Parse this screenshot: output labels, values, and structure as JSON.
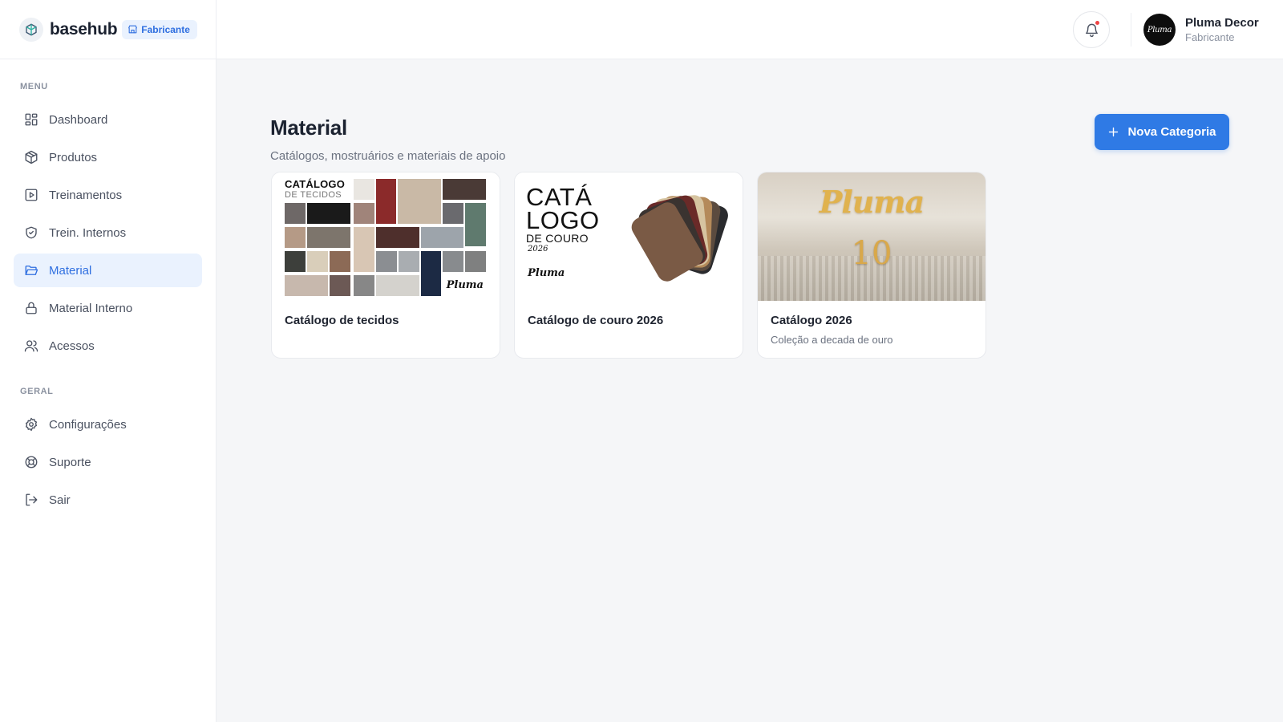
{
  "brand": {
    "name": "basehub",
    "badge": "Fabricante"
  },
  "sidebar": {
    "menu_label": "MENU",
    "menu_items": [
      {
        "label": "Dashboard",
        "icon": "grid-icon"
      },
      {
        "label": "Produtos",
        "icon": "box-icon"
      },
      {
        "label": "Treinamentos",
        "icon": "play-square-icon"
      },
      {
        "label": "Trein. Internos",
        "icon": "shield-icon"
      },
      {
        "label": "Material",
        "icon": "folder-open-icon",
        "active": true
      },
      {
        "label": "Material Interno",
        "icon": "lock-icon"
      },
      {
        "label": "Acessos",
        "icon": "users-icon"
      }
    ],
    "general_label": "GERAL",
    "general_items": [
      {
        "label": "Configurações",
        "icon": "gear-icon"
      },
      {
        "label": "Suporte",
        "icon": "lifebuoy-icon"
      },
      {
        "label": "Sair",
        "icon": "logout-icon"
      }
    ]
  },
  "header": {
    "user": {
      "name": "Pluma Decor",
      "role": "Fabricante",
      "avatar_text": "Pluma"
    }
  },
  "main": {
    "title": "Material",
    "subtitle": "Catálogos, mostruários e materiais de apoio",
    "new_button": "Nova Categoria",
    "cards": [
      {
        "title": "Catálogo de tecidos",
        "description": "",
        "thumb": {
          "heading": "CATÁLOGO",
          "subheading": "DE TECIDOS",
          "logo": "Pluma"
        }
      },
      {
        "title": "Catálogo de couro 2026",
        "description": "",
        "thumb": {
          "heading_line1": "CATÁ",
          "heading_line2": "LOGO",
          "subheading": "DE COURO",
          "year": "2026",
          "logo": "Pluma"
        }
      },
      {
        "title": "Catálogo 2026",
        "description": "Coleção a decada de ouro",
        "thumb": {
          "logo": "Pluma",
          "number": "10"
        }
      }
    ]
  },
  "colors": {
    "accent": "#2f7ae5",
    "active_bg": "#eaf2fe",
    "active_text": "#2f6fe0",
    "background": "#f5f6f8"
  }
}
